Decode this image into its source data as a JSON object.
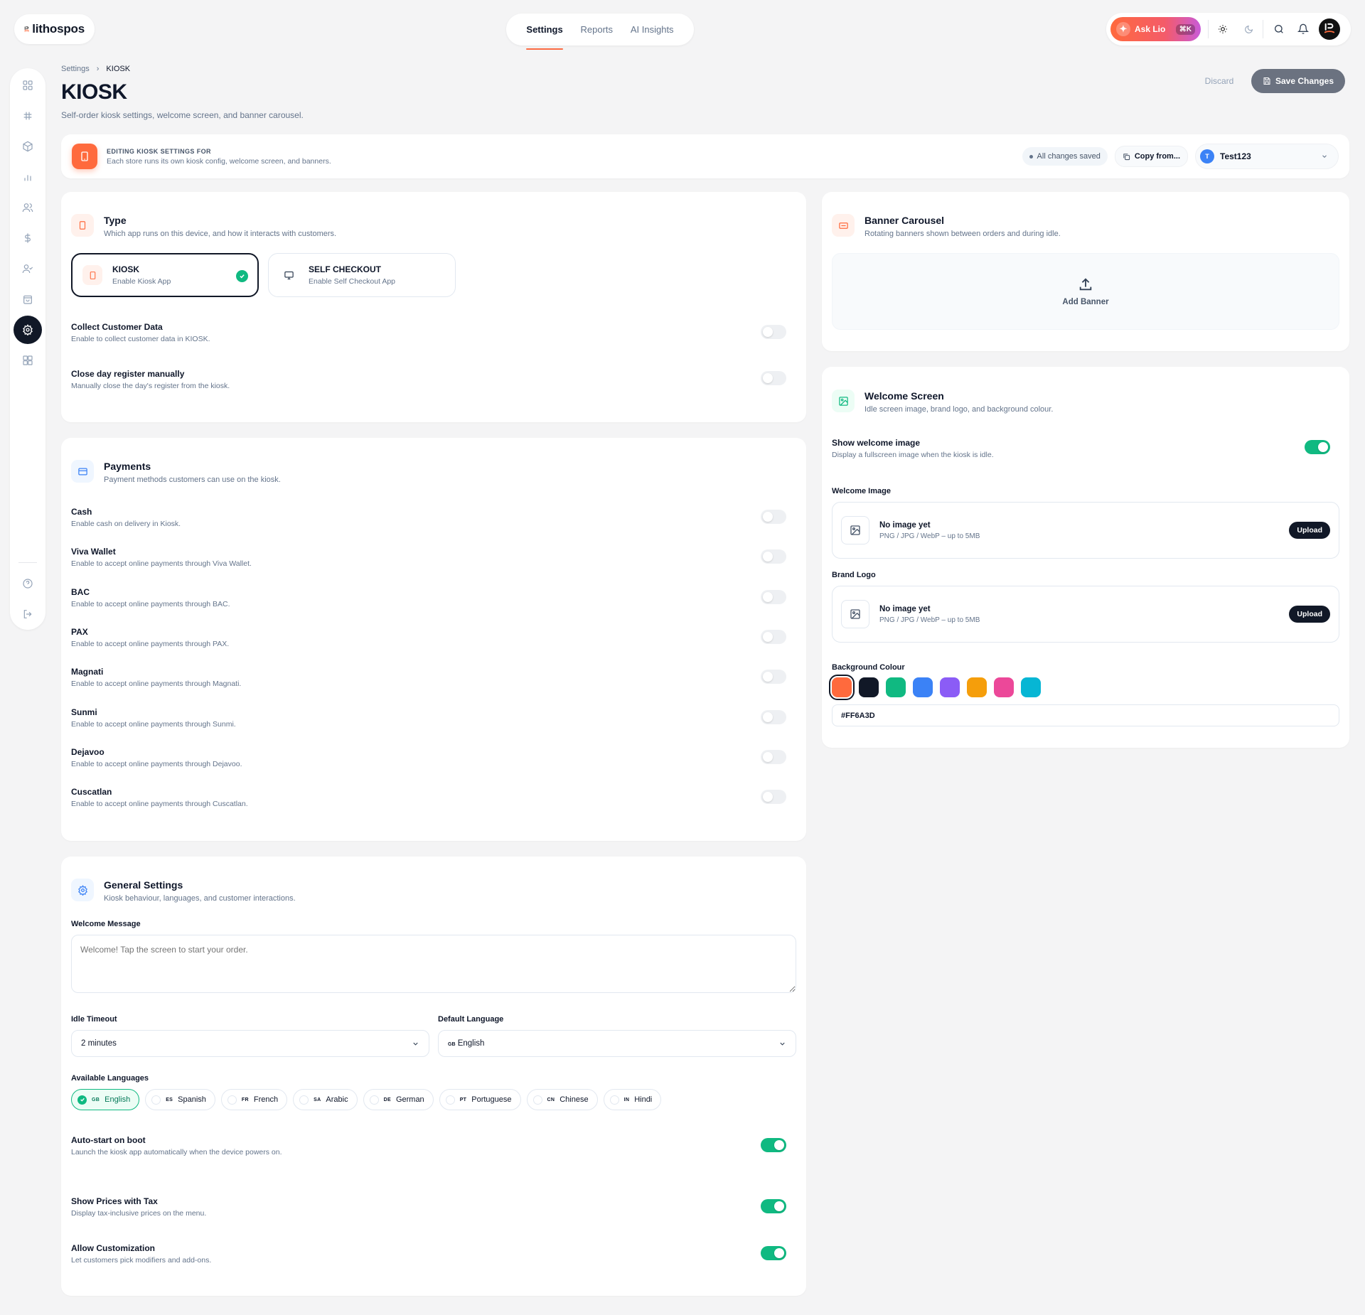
{
  "app": {
    "name": "lithospos"
  },
  "nav": {
    "tabs": [
      {
        "label": "Settings"
      },
      {
        "label": "Reports"
      },
      {
        "label": "AI Insights"
      }
    ]
  },
  "topbar": {
    "ask_label": "Ask Lio",
    "ask_shortcut": "⌘K"
  },
  "page": {
    "breadcrumb_parent": "Settings",
    "breadcrumb_current": "KIOSK",
    "title": "KIOSK",
    "subtitle": "Self-order kiosk settings, welcome screen, and banner carousel.",
    "discard_label": "Discard",
    "save_label": "Save Changes"
  },
  "editing": {
    "heading": "EDITING KIOSK SETTINGS FOR",
    "description": "Each store runs its own kiosk config, welcome screen, and banners.",
    "status": "All changes saved",
    "copy_label": "Copy from...",
    "store_initial": "T",
    "store_name": "Test123"
  },
  "type": {
    "title": "Type",
    "subtitle": "Which app runs on this device, and how it interacts with customers.",
    "options": [
      {
        "title": "KIOSK",
        "subtitle": "Enable Kiosk App",
        "selected": true
      },
      {
        "title": "SELF CHECKOUT",
        "subtitle": "Enable Self Checkout App",
        "selected": false
      }
    ],
    "settings": [
      {
        "title": "Collect Customer Data",
        "subtitle": "Enable to collect customer data in KIOSK.",
        "enabled": false
      },
      {
        "title": "Close day register manually",
        "subtitle": "Manually close the day's register from the kiosk.",
        "enabled": false
      }
    ]
  },
  "payments": {
    "title": "Payments",
    "subtitle": "Payment methods customers can use on the kiosk.",
    "methods": [
      {
        "title": "Cash",
        "subtitle": "Enable cash on delivery in Kiosk.",
        "enabled": false
      },
      {
        "title": "Viva Wallet",
        "subtitle": "Enable to accept online payments through Viva Wallet.",
        "enabled": false
      },
      {
        "title": "BAC",
        "subtitle": "Enable to accept online payments through BAC.",
        "enabled": false
      },
      {
        "title": "PAX",
        "subtitle": "Enable to accept online payments through PAX.",
        "enabled": false
      },
      {
        "title": "Magnati",
        "subtitle": "Enable to accept online payments through Magnati.",
        "enabled": false
      },
      {
        "title": "Sunmi",
        "subtitle": "Enable to accept online payments through Sunmi.",
        "enabled": false
      },
      {
        "title": "Dejavoo",
        "subtitle": "Enable to accept online payments through Dejavoo.",
        "enabled": false
      },
      {
        "title": "Cuscatlan",
        "subtitle": "Enable to accept online payments through Cuscatlan.",
        "enabled": false
      }
    ]
  },
  "general": {
    "title": "General Settings",
    "subtitle": "Kiosk behaviour, languages, and customer interactions.",
    "welcome_label": "Welcome Message",
    "welcome_placeholder": "Welcome! Tap the screen to start your order.",
    "idle_label": "Idle Timeout",
    "idle_value": "2 minutes",
    "default_lang_label": "Default Language",
    "default_lang_flag": "GB",
    "default_lang_value": "English",
    "available_label": "Available Languages",
    "languages": [
      {
        "code": "GB",
        "name": "English",
        "selected": true
      },
      {
        "code": "ES",
        "name": "Spanish",
        "selected": false
      },
      {
        "code": "FR",
        "name": "French",
        "selected": false
      },
      {
        "code": "SA",
        "name": "Arabic",
        "selected": false
      },
      {
        "code": "DE",
        "name": "German",
        "selected": false
      },
      {
        "code": "PT",
        "name": "Portuguese",
        "selected": false
      },
      {
        "code": "CN",
        "name": "Chinese",
        "selected": false
      },
      {
        "code": "IN",
        "name": "Hindi",
        "selected": false
      }
    ],
    "settings": [
      {
        "title": "Auto-start on boot",
        "subtitle": "Launch the kiosk app automatically when the device powers on.",
        "enabled": true
      },
      {
        "title": "Show Prices with Tax",
        "subtitle": "Display tax-inclusive prices on the menu.",
        "enabled": true
      },
      {
        "title": "Allow Customization",
        "subtitle": "Let customers pick modifiers and add-ons.",
        "enabled": true
      }
    ]
  },
  "banner": {
    "title": "Banner Carousel",
    "subtitle": "Rotating banners shown between orders and during idle.",
    "add_label": "Add Banner"
  },
  "welcome": {
    "title": "Welcome Screen",
    "subtitle": "Idle screen image, brand logo, and background colour.",
    "show_title": "Show welcome image",
    "show_subtitle": "Display a fullscreen image when the kiosk is idle.",
    "show_enabled": true,
    "image_label": "Welcome Image",
    "logo_label": "Brand Logo",
    "empty_title": "No image yet",
    "empty_hint": "PNG / JPG / WebP – up to 5MB",
    "upload_label": "Upload",
    "bg_label": "Background Colour",
    "bg_value": "#FF6A3D",
    "colors": [
      "#FF6A3D",
      "#111827",
      "#10B981",
      "#3B82F6",
      "#8B5CF6",
      "#F59E0B",
      "#EC4899",
      "#06B6D4"
    ]
  },
  "colors": {
    "accent": "#FF6A3D",
    "success": "#10B981",
    "dark": "#111827"
  }
}
